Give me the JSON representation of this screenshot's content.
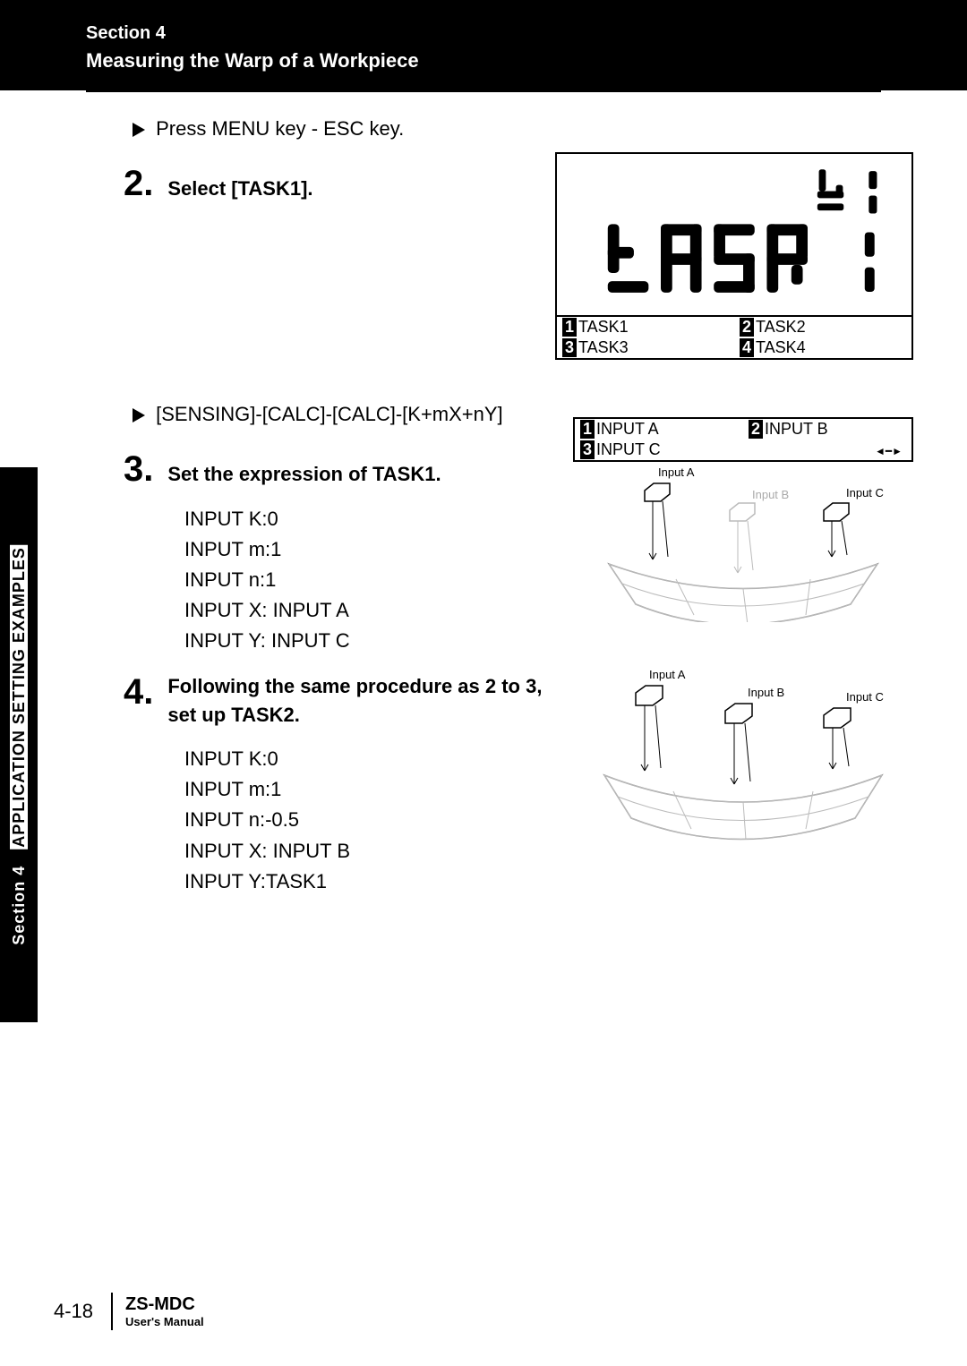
{
  "header": {
    "section_small": "Section 4",
    "section_title": "Measuring the Warp of a Workpiece"
  },
  "side_tab": {
    "section": "Section 4",
    "title": "APPLICATION SETTING EXAMPLES"
  },
  "body": {
    "press_line": "Press MENU key - ESC key.",
    "step2": {
      "num": "2.",
      "text": "Select [TASK1]."
    },
    "sensing_line": "[SENSING]-[CALC]-[CALC]-[K+mX+nY]",
    "step3": {
      "num": "3.",
      "text": "Set the expression of TASK1."
    },
    "inputs1": {
      "k": "INPUT K:0",
      "m": "INPUT m:1",
      "n": "INPUT n:1",
      "x": "INPUT X: INPUT A",
      "y": "INPUT Y: INPUT C"
    },
    "step4": {
      "num": "4.",
      "text": "Following the same procedure as 2 to 3, set up TASK2."
    },
    "inputs2": {
      "k": "INPUT K:0",
      "m": "INPUT m:1",
      "n": "INPUT n:-0.5",
      "x": "INPUT X: INPUT B",
      "y": "INPUT Y:TASK1"
    }
  },
  "lcd": {
    "menu": {
      "t1": "TASK1",
      "t2": "TASK2",
      "t3": "TASK3",
      "t4": "TASK4"
    },
    "keys": {
      "k1": "1",
      "k2": "2",
      "k3": "3",
      "k4": "4"
    }
  },
  "fig1": {
    "in_a": "INPUT A",
    "in_b": "INPUT B",
    "in_c": "INPUT C",
    "k1": "1",
    "k2": "2",
    "k3": "3",
    "lbl_a": "Input A",
    "lbl_b": "Input B",
    "lbl_c": "Input C"
  },
  "fig2": {
    "lbl_a": "Input A",
    "lbl_b": "Input B",
    "lbl_c": "Input C"
  },
  "footer": {
    "pagenum": "4-18",
    "manual_title": "ZS-MDC",
    "manual_sub": "User's Manual"
  }
}
